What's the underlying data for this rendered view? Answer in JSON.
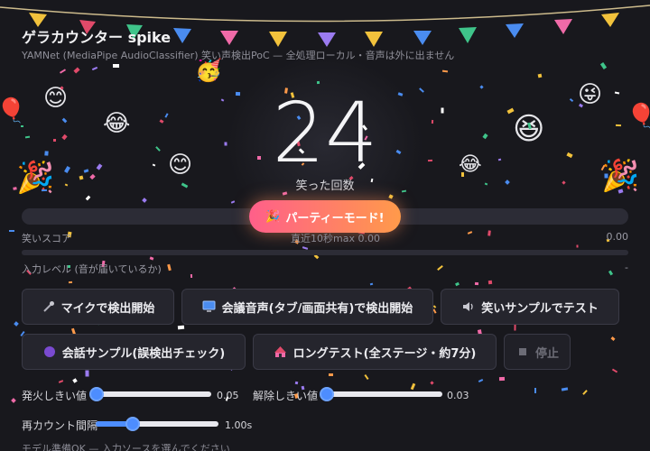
{
  "app": {
    "title": "ゲラカウンター spike",
    "subtitle": "YAMNet (MediaPipe AudioClassifier) 笑い声検出PoC — 全処理ローカル・音声は外に出ません"
  },
  "counter": {
    "value": "24",
    "label": "笑った回数"
  },
  "party_button": {
    "label": "パーティーモード!",
    "icon": "party-popper-icon"
  },
  "score": {
    "label": "笑いスコア",
    "window_text": "直近10秒max 0.00",
    "value_text": "0.00",
    "fill_fraction": 0.0
  },
  "input_level": {
    "label": "入力レベル (音が届いているか)",
    "value_text": "-",
    "fill_fraction": 0.0
  },
  "buttons": {
    "mic": {
      "label": "マイクで検出開始",
      "icon": "microphone-icon"
    },
    "meeting": {
      "label": "会議音声(タブ/画面共有)で検出開始",
      "icon": "monitor-icon"
    },
    "sample": {
      "label": "笑いサンプルでテスト",
      "icon": "speaker-icon"
    },
    "conversation": {
      "label": "会話サンプル(誤検出チェック)",
      "icon": "purple-circle-icon"
    },
    "long_test": {
      "label": "ロングテスト(全ステージ・約7分)",
      "icon": "circus-tent-icon"
    },
    "stop": {
      "label": "停止",
      "icon": "stop-square-icon"
    }
  },
  "sliders": {
    "fire_threshold": {
      "label": "発火しきい値",
      "value_text": "0.05",
      "fraction": 0.05
    },
    "release_threshold": {
      "label": "解除しきい値",
      "value_text": "0.03",
      "fraction": 0.03
    },
    "recount_interval": {
      "label": "再カウント間隔",
      "value_text": "1.00s",
      "fraction": 0.3
    }
  },
  "status": {
    "text": "モデル準備OK — 入力ソースを選んでください"
  },
  "colors": {
    "background": "#18181d",
    "accent_party_start": "#ff5f8a",
    "accent_party_end": "#ff9a4a",
    "slider_accent": "#4d8dff"
  }
}
